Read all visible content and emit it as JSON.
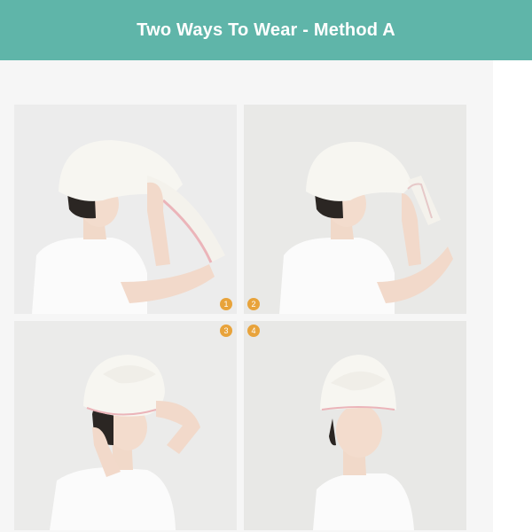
{
  "header": {
    "title": "Two Ways To Wear - Method A"
  },
  "steps": [
    "1",
    "2",
    "3",
    "4"
  ],
  "colors": {
    "banner": "#5fb5a9",
    "badge": "#e8a33b",
    "page_background": "#f6f6f6"
  },
  "photos": [
    {
      "name": "step-1-photo",
      "subject": "wrapping towel over head, holding towel end"
    },
    {
      "name": "step-2-photo",
      "subject": "twisting the towel"
    },
    {
      "name": "step-3-photo",
      "subject": "flipping twisted towel over head"
    },
    {
      "name": "step-4-photo",
      "subject": "towel secured as turban"
    }
  ]
}
